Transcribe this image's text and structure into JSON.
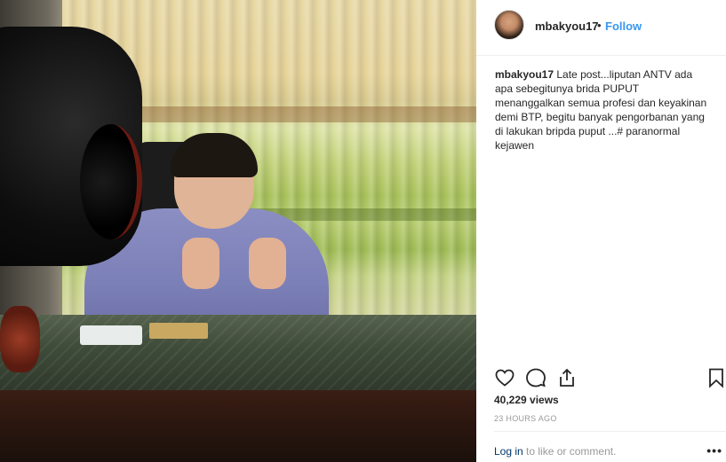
{
  "post": {
    "username": "mbakyou17",
    "separator": "•",
    "follow_label": "Follow",
    "caption_user": "mbakyou17",
    "caption_text": "Late post...liputan ANTV ada apa sebegitunya brida PUPUT menanggalkan semua profesi dan keyakinan demi BTP, begitu banyak pengorbanan yang di lakukan bripda puput ...# paranormal kejawen",
    "views": "40,229 views",
    "timestamp": "23 HOURS AGO",
    "login_link": "Log in",
    "login_suffix": " to like or comment.",
    "more_label": "•••"
  },
  "icons": {
    "like": "heart-icon",
    "comment": "comment-icon",
    "share": "share-icon",
    "save": "bookmark-icon",
    "more": "more-options-icon"
  },
  "colors": {
    "accent": "#3897f0",
    "link": "#003569",
    "muted": "#999999",
    "text": "#262626"
  }
}
